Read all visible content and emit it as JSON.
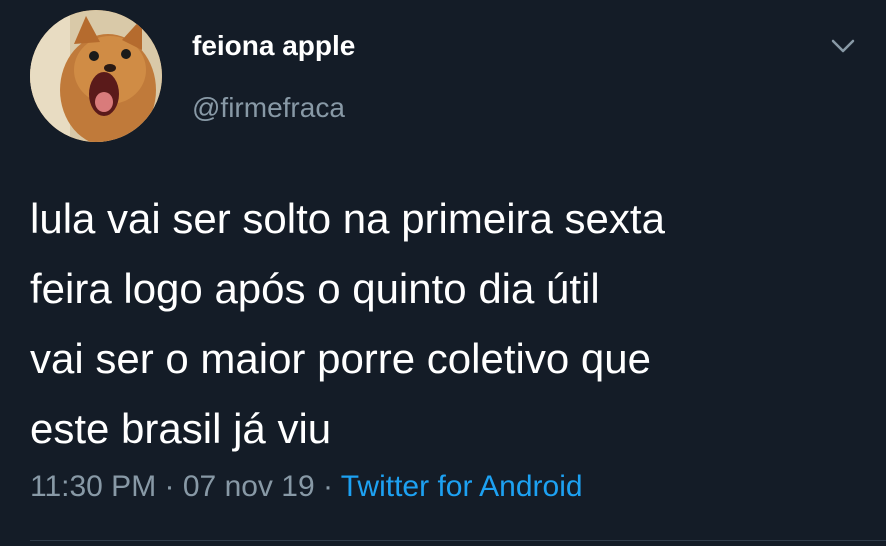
{
  "user": {
    "display_name": "feiona apple",
    "handle": "@firmefraca"
  },
  "tweet": {
    "lines": [
      "lula vai ser solto na primeira sexta",
      "feira logo após o quinto dia útil",
      "vai ser o maior porre coletivo que",
      "este brasil já viu"
    ]
  },
  "meta": {
    "time": "11:30 PM",
    "date": "07 nov 19",
    "separator": " · ",
    "source": "Twitter for Android"
  },
  "colors": {
    "background": "#141c27",
    "text": "#ffffff",
    "secondary_text": "#8899a6",
    "link": "#1da1f2"
  },
  "icons": {
    "avatar": "dog-avatar-icon",
    "menu": "chevron-down-icon"
  }
}
